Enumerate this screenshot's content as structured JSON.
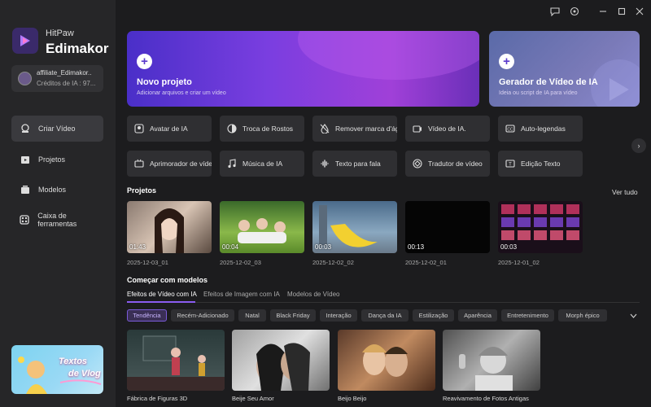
{
  "app": {
    "brand_line1": "HitPaw",
    "brand_line2": "Edimakor"
  },
  "account": {
    "name": "affiliate_Edimakor..",
    "credits": "Créditos de IA : 97..."
  },
  "nav": [
    {
      "label": "Criar Vídeo",
      "icon": "create-video-icon"
    },
    {
      "label": "Projetos",
      "icon": "projects-icon"
    },
    {
      "label": "Modelos",
      "icon": "templates-icon"
    },
    {
      "label": "Caixa de ferramentas",
      "icon": "toolbox-icon"
    }
  ],
  "promo": {
    "line1": "Textos",
    "line2": "de Vlog"
  },
  "hero": {
    "new_project": {
      "title": "Novo projeto",
      "subtitle": "Adicionar arquivos e criar um vídeo"
    },
    "ai_video": {
      "title": "Gerador de Vídeo de IA",
      "subtitle": "Ideia ou script de IA para vídeo"
    }
  },
  "tools": [
    {
      "label": "Avatar de IA",
      "icon": "avatar-icon"
    },
    {
      "label": "Troca de Rostos",
      "icon": "face-swap-icon"
    },
    {
      "label": "Remover marca d'água",
      "icon": "watermark-remove-icon"
    },
    {
      "label": "Vídeo de IA.",
      "icon": "ai-video-icon"
    },
    {
      "label": "Auto-legendas",
      "icon": "subtitles-icon"
    },
    {
      "label": "Aprimorador de vídeo",
      "icon": "enhancer-icon"
    },
    {
      "label": "Música de IA",
      "icon": "music-icon"
    },
    {
      "label": "Texto para fala",
      "icon": "tts-icon"
    },
    {
      "label": "Tradutor de vídeo",
      "icon": "translator-icon"
    },
    {
      "label": "Edição Texto",
      "icon": "text-edit-icon"
    }
  ],
  "projects": {
    "title": "Projetos",
    "see_all": "Ver tudo",
    "items": [
      {
        "duration": "01:43",
        "date": "2025-12-03_01"
      },
      {
        "duration": "00:04",
        "date": "2025-12-02_03"
      },
      {
        "duration": "00:03",
        "date": "2025-12-02_02"
      },
      {
        "duration": "00:13",
        "date": "2025-12-02_01"
      },
      {
        "duration": "00:03",
        "date": "2025-12-01_02"
      }
    ]
  },
  "templates": {
    "title": "Começar com modelos",
    "tabs": [
      "Efeitos de Vídeo com IA",
      "Efeitos de Imagem com IA",
      "Modelos de Vídeo"
    ],
    "chips": [
      "Tendência",
      "Recém-Adicionado",
      "Natal",
      "Black Friday",
      "Interação",
      "Dança da IA",
      "Estilização",
      "Aparência",
      "Entretenimento",
      "Morph épico"
    ],
    "cards": [
      "Fábrica de Figuras 3D",
      "Beije Seu Amor",
      "Beijo Beijo",
      "Reavivamento de Fotos Antigas"
    ]
  },
  "colors": {
    "accent": "#8a5cf0",
    "bg": "#1c1c1e",
    "sidebar": "#262628"
  }
}
